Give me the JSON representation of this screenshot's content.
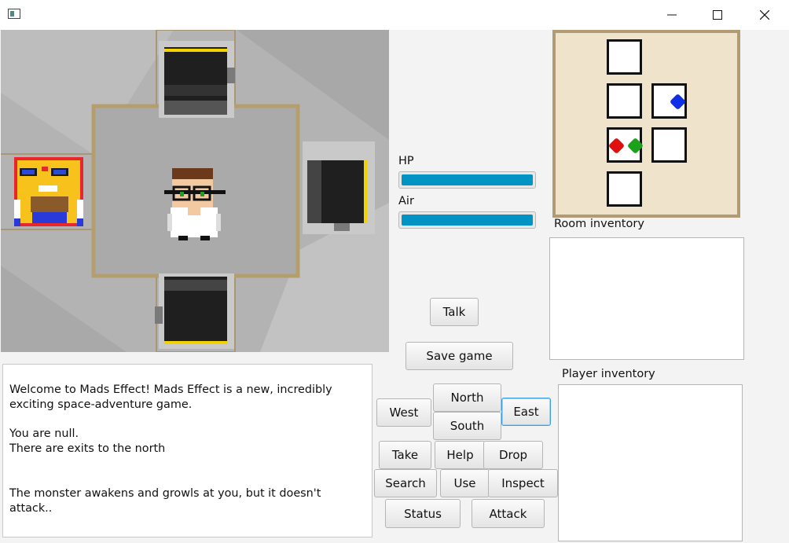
{
  "window": {
    "minimize_icon": "minimize-icon",
    "maximize_icon": "maximize-icon",
    "close_icon": "close-icon"
  },
  "stats": {
    "hp_label": "HP",
    "hp_value": 1.0,
    "air_label": "Air",
    "air_value": 1.0,
    "bar_color": "#0093c4"
  },
  "log": {
    "p1_l1": "Welcome to Mads Effect! Mads Effect is a new, incredibly",
    "p1_l2": "exciting space-adventure game.",
    "p2_l1": "You are null.",
    "p2_l2": "There are exits to the north",
    "p3_l1": "The monster awakens and growls at you, but it doesn't attack.."
  },
  "buttons": {
    "talk": "Talk",
    "save": "Save game",
    "west": "West",
    "north": "North",
    "south": "South",
    "east": "East",
    "take": "Take",
    "help": "Help",
    "drop": "Drop",
    "search": "Search",
    "use": "Use",
    "inspect": "Inspect",
    "status": "Status",
    "attack": "Attack"
  },
  "inventory": {
    "room_label": "Room inventory",
    "player_label": "Player inventory"
  },
  "minimap": {
    "marker_colors": {
      "red": "#e01010",
      "green": "#1aa31a",
      "blue": "#1030e8"
    }
  }
}
